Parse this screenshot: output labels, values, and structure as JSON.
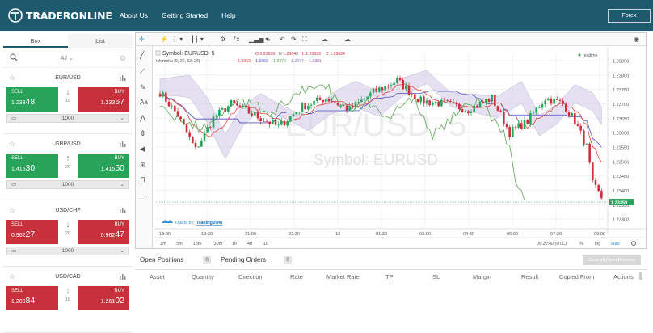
{
  "header": {
    "logo_text": "TRADERONLINE",
    "nav": [
      "About Us",
      "Getting Started",
      "Help"
    ],
    "account_button": "Forex"
  },
  "sidebar": {
    "tabs": [
      "Box",
      "List"
    ],
    "filter": "All",
    "pairs": [
      {
        "name": "EUR/USD",
        "direction": "down",
        "spread": "19",
        "sell_label": "SELL",
        "sell_prefix": "1.233",
        "sell_big": "48",
        "buy_label": "BUY",
        "buy_prefix": "1.233",
        "buy_big": "67",
        "amount": "1000",
        "sell_color": "#27a35a",
        "buy_color": "#c8313c"
      },
      {
        "name": "GBP/USD",
        "direction": "up",
        "spread": "20",
        "sell_label": "SELL",
        "sell_prefix": "1.415",
        "sell_big": "30",
        "buy_label": "BUY",
        "buy_prefix": "1.415",
        "buy_big": "50",
        "amount": "1000",
        "sell_color": "#27a35a",
        "buy_color": "#27a35a"
      },
      {
        "name": "USD/CHF",
        "direction": "down",
        "spread": "20",
        "sell_label": "SELL",
        "sell_prefix": "0.962",
        "sell_big": "27",
        "buy_label": "BUY",
        "buy_prefix": "0.962",
        "buy_big": "47",
        "amount": "1000",
        "sell_color": "#c8313c",
        "buy_color": "#c8313c"
      },
      {
        "name": "USD/CAD",
        "direction": "down",
        "spread": "18",
        "sell_label": "SELL",
        "sell_prefix": "1.260",
        "sell_big": "84",
        "buy_label": "BUY",
        "buy_prefix": "1.261",
        "buy_big": "02",
        "amount": "",
        "sell_color": "#c8313c",
        "buy_color": "#c8313c"
      }
    ]
  },
  "chart": {
    "legend_symbol": "Symbol: EURUSD, 5",
    "ohlc": {
      "o": "O 1.23639",
      "h": "H 1.23643",
      "l": "L 1.23633",
      "c": "C 1.23634"
    },
    "ichimoku_label": "Ichimoku (9, 26, 52, 26)",
    "ichimoku_values": [
      "1.2363",
      "1.2362",
      "1.2370",
      "1.2377",
      "1.2381"
    ],
    "realtime": "realtime",
    "watermark_big": "EUR/USD, 5",
    "watermark_small": "Symbol: EURUSD",
    "attribution_prefix": "charts by ",
    "attribution_link": "TradingView",
    "last_price": "1.23359",
    "price_axis": [
      "1.23850",
      "1.23800",
      "1.23750",
      "1.23700",
      "1.23650",
      "1.23600",
      "1.23550",
      "1.23500",
      "1.23450",
      "1.23400",
      "1.23350",
      "1.23300"
    ],
    "time_axis": [
      "18:00",
      "19:30",
      "21:00",
      "22:30",
      "12",
      "01:30",
      "03:00",
      "04:30",
      "06:00",
      "07:30",
      "09:00"
    ],
    "ranges": [
      "1m",
      "5m",
      "15m",
      "30m",
      "1h",
      "4h",
      "1d"
    ],
    "clock": "09:20:40 (UTC)",
    "scale_options": [
      "%",
      "log",
      "auto"
    ],
    "colors": {
      "up": "#26a65b",
      "down": "#cc2f3c",
      "cloud": "#d3cde6",
      "tenkan": "#e0463c",
      "kijun": "#4f50c8",
      "chikou": "#5aa64f"
    }
  },
  "positions": {
    "tabs": [
      {
        "label": "Open Positions",
        "count": "0"
      },
      {
        "label": "Pending Orders",
        "count": "0"
      }
    ],
    "close_all": "Close all Open Positions",
    "columns": [
      "Asset",
      "Quantity",
      "Direction",
      "Rate",
      "Market Rate",
      "TP",
      "SL",
      "Margin",
      "Result",
      "Copied From",
      "Actions"
    ]
  }
}
